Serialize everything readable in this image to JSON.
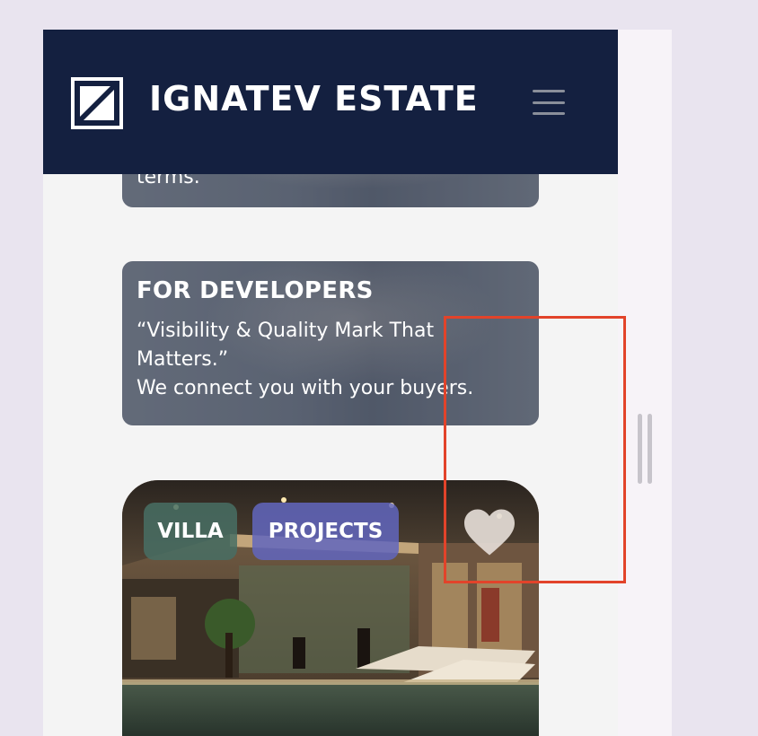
{
  "header": {
    "brand": "IGNATEV ESTATE",
    "logo_icon": "square-frame-logo",
    "menu_icon": "hamburger-menu-icon"
  },
  "cards": {
    "top_card_text": "terms.",
    "developers": {
      "title": "FOR DEVELOPERS",
      "quote_line1": "“Visibility & Quality Mark That",
      "quote_line2": "Matters.”",
      "body": "We connect you with your buyers."
    }
  },
  "listing": {
    "tags": [
      "VILLA",
      "PROJECTS"
    ],
    "favorite_icon": "heart-icon"
  },
  "colors": {
    "header_bg": "#142040",
    "tag_villa": "#486e64",
    "tag_projects": "#6266be",
    "highlight": "#e2432a"
  }
}
